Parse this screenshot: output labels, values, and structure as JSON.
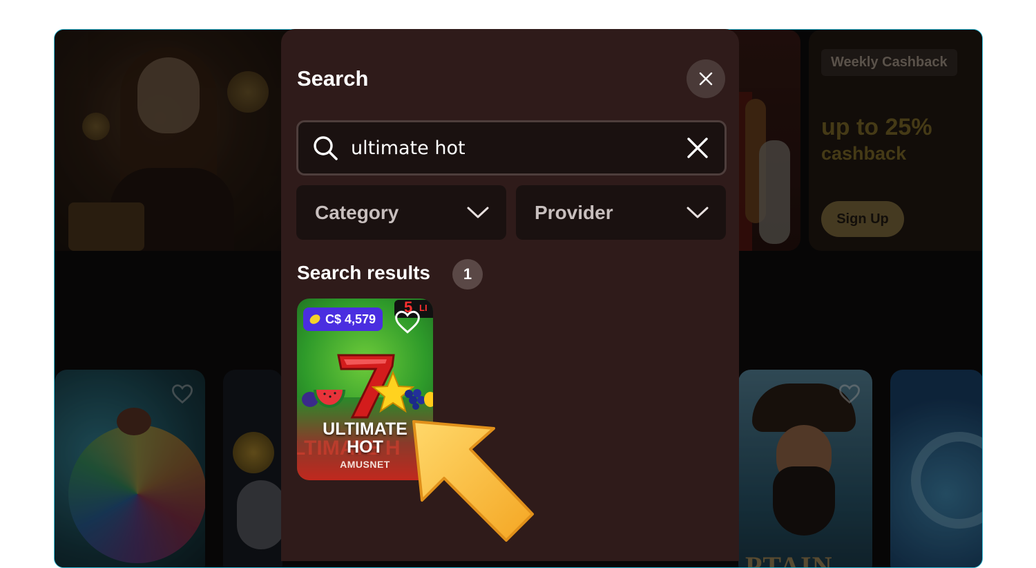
{
  "modal": {
    "title": "Search",
    "search": {
      "value": "ultimate hot",
      "placeholder": ""
    },
    "filters": [
      {
        "label": "Category"
      },
      {
        "label": "Provider"
      }
    ],
    "results_label": "Search results",
    "results_count": "1"
  },
  "game_card": {
    "jackpot": "C$ 4,579",
    "lines_number": "5",
    "lines_text": "LI",
    "title_line1": "ULTIMATE",
    "title_line2": "HOT",
    "provider": "AMUSNET",
    "ghost_text": "LTIMATE H"
  },
  "promo": {
    "badge": "Weekly Cashback",
    "headline": "up to 25%",
    "subline": "cashback",
    "button": "Sign Up"
  },
  "background_tiles": {
    "pirate_word": "PTAIN"
  },
  "colors": {
    "modal_bg": "#2f1b1a",
    "input_bg": "#1a1110",
    "jackpot_badge": "#4a2ee0",
    "frame_border": "#2bb8d6",
    "arrow": "#f7b733"
  },
  "icons": [
    "search-icon",
    "close-icon",
    "clear-icon",
    "chevron-down-icon",
    "heart-icon",
    "lemon-icon",
    "arrow-pointer-icon"
  ]
}
